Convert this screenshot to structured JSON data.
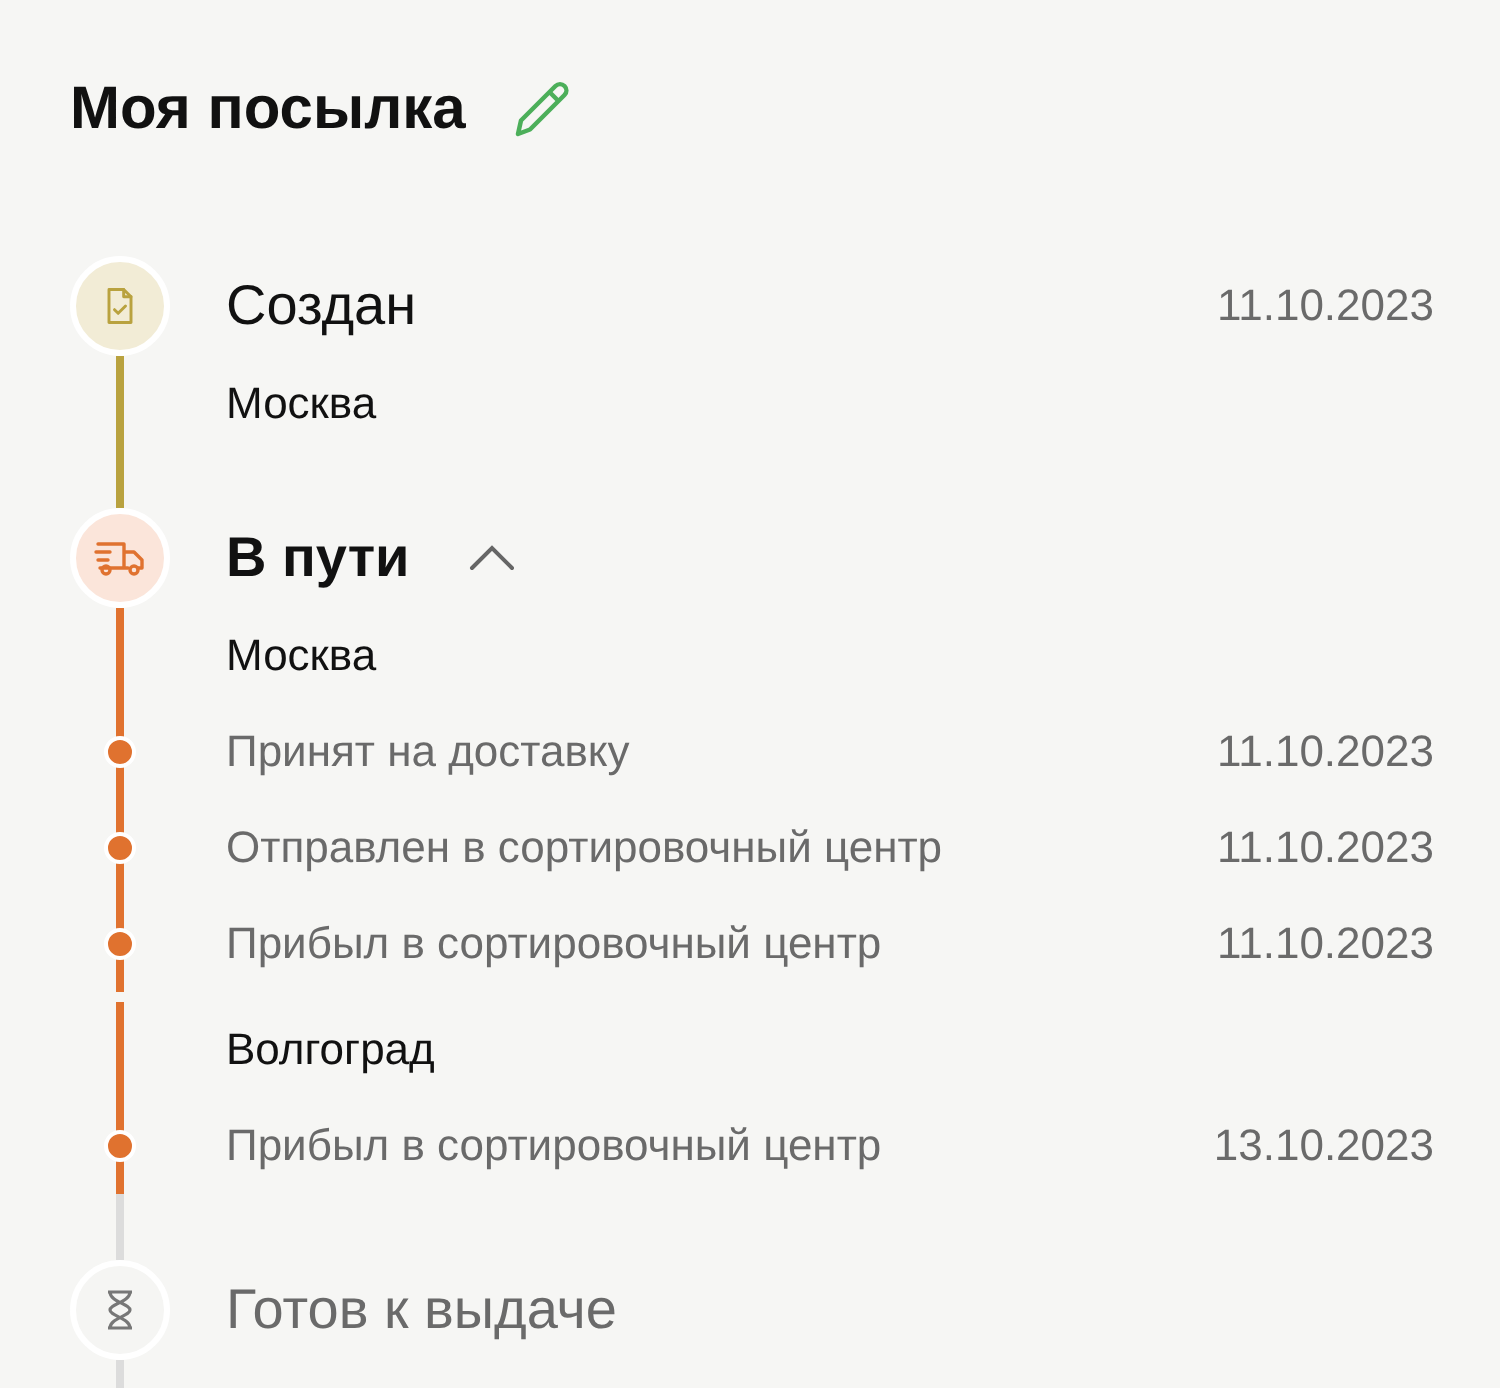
{
  "title": "Моя посылка",
  "stages": [
    {
      "kind": "created",
      "current": false,
      "reached": true,
      "color": "#b9a23f",
      "title": "Создан",
      "date": "11.10.2023",
      "groups": [
        {
          "city": "Москва"
        }
      ]
    },
    {
      "kind": "transit",
      "current": true,
      "reached": true,
      "color": "#e0722f",
      "title": "В пути",
      "expanded": true,
      "groups": [
        {
          "city": "Москва",
          "events": [
            {
              "text": "Принят на доставку",
              "date": "11.10.2023"
            },
            {
              "text": "Отправлен в сортировочный центр",
              "date": "11.10.2023"
            },
            {
              "text": "Прибыл в сортировочный центр",
              "date": "11.10.2023"
            }
          ]
        },
        {
          "city": "Волгоград",
          "events": [
            {
              "text": "Прибыл в сортировочный центр",
              "date": "13.10.2023"
            }
          ]
        }
      ]
    },
    {
      "kind": "ready",
      "current": false,
      "reached": false,
      "color": "#dcdcdc",
      "title": "Готов к выдаче"
    }
  ]
}
